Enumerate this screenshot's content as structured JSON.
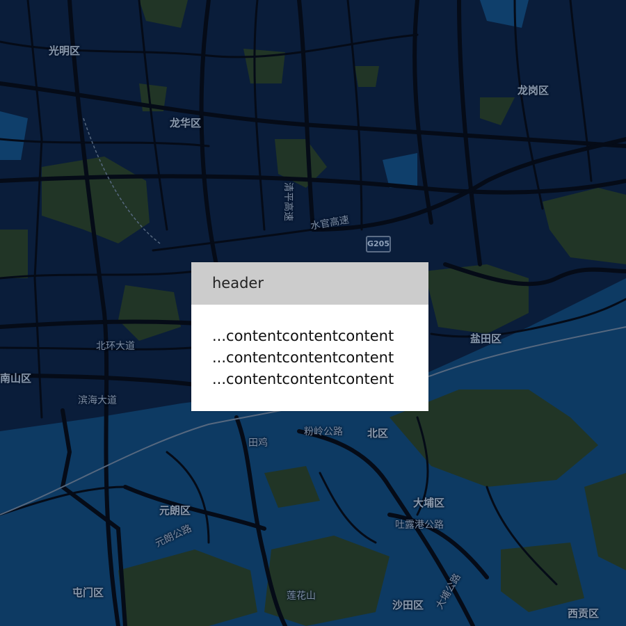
{
  "map": {
    "districts": [
      "光明区",
      "龙华区",
      "龙岗区",
      "盐田区",
      "北区",
      "大埔区",
      "元朗区",
      "屯门区",
      "沙田区",
      "西贡区",
      "南山区",
      "莲花山"
    ],
    "roads": [
      "北环大道",
      "滨海大道",
      "粉岭公路",
      "吐露港公路",
      "元朗公路",
      "清平高速",
      "水官高速",
      "G205",
      "田鸡",
      "大埔公路"
    ],
    "colors": {
      "water": "#0a1d3a",
      "land_green": "#213526",
      "sea": "#0d3a63",
      "road": "#050b17"
    }
  },
  "popup": {
    "header": "header",
    "lines": [
      "...contentcontentcontent",
      "...contentcontentcontent",
      "...contentcontentcontent"
    ]
  }
}
